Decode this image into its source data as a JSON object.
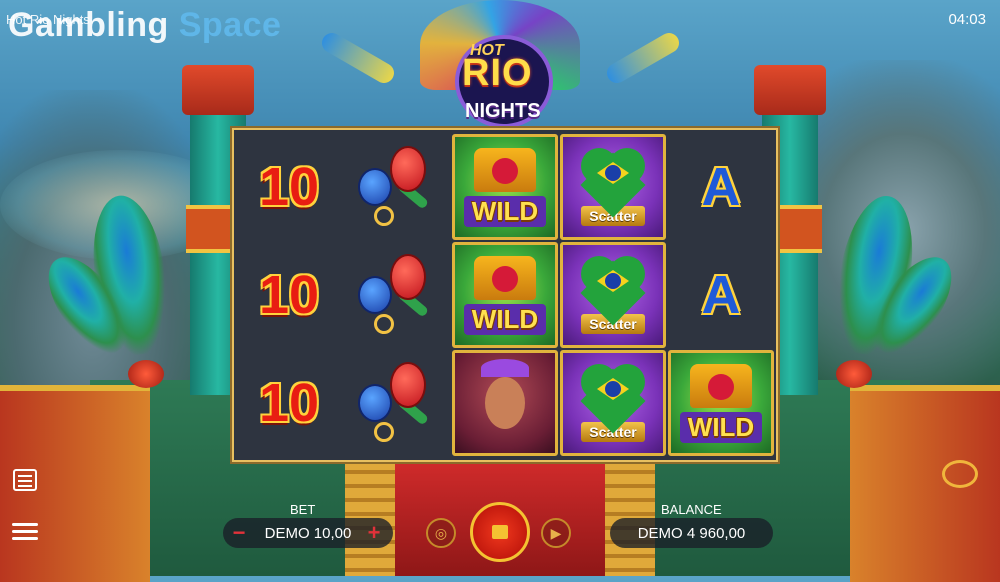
{
  "watermark": {
    "part1": "Gambling",
    "part2": "Space"
  },
  "tab_title": "Hot Rio Nights",
  "clock": "04:03",
  "logo": {
    "hot": "HOT",
    "rio": "RIO",
    "nights": "NIGHTS"
  },
  "reels": [
    [
      "10",
      "10",
      "10"
    ],
    [
      "maracas",
      "maracas",
      "maracas"
    ],
    [
      "WILD",
      "WILD",
      "dancer"
    ],
    [
      "Scatter",
      "Scatter",
      "Scatter"
    ],
    [
      "A",
      "A",
      "WILD"
    ]
  ],
  "symbols": {
    "wild": "WILD",
    "scatter": "Scatter",
    "ten": "10",
    "ace": "A"
  },
  "bet": {
    "label": "BET",
    "value": "DEMO 10,00",
    "minus": "−",
    "plus": "+"
  },
  "balance": {
    "label": "BALANCE",
    "value": "DEMO 4 960,00"
  },
  "colors": {
    "accent": "#e2323a",
    "gold": "#f4c332",
    "reel_bg": "#2e3440"
  }
}
